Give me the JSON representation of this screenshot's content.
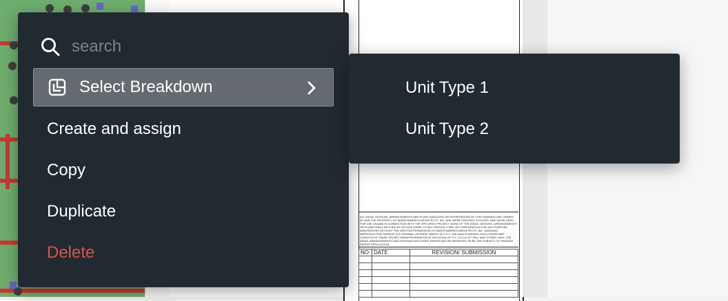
{
  "menu": {
    "search": {
      "placeholder": "search"
    },
    "items": [
      {
        "label": "Select Breakdown",
        "has_submenu": true,
        "active": true
      },
      {
        "label": "Create and assign"
      },
      {
        "label": "Copy"
      },
      {
        "label": "Duplicate"
      },
      {
        "label": "Delete",
        "danger": true
      }
    ]
  },
  "submenu": {
    "items": [
      {
        "label": "Unit Type 1"
      },
      {
        "label": "Unit Type 2"
      }
    ]
  },
  "drawing": {
    "notes": "ALL IDEAS, DESIGNS, ARRANGEMENTS AND PLANS INDICATED OR REPRESENTED BY THIS DRAWING ARE OWNED BY AND THE PROPERTY OF BAKER BARRIOS ARCHITECTS, INC. AND WERE CREATED, EVOLVED, AND DEVELOPED FOR USE ON AND IN CONNECTION WITH THE SPECIFIED PROJECT. NONE OF THE IDEAS, DESIGNS, ARRANGEMENTS OR PLANS SHALL BE USED BY OR DISCLOSED TO ANY PERSON, FIRM, OR CORPORATION FOR ANY PURPOSE WHATSOEVER WITHOUT THE WRITTEN PERMISSION OF BAKER BARRIOS ARCHITECTS, INC. WARNING: REPRODUCTION HEREOF IS A CRIMINAL OFFENSE UNDER 18 U.S.C. 506 UNAUTHORIZED DISCLOSURE MAY CONSTITUTE TRADE SECRET MISAPPROPRIATION IN VIOLATION OF S.C. 24-2-21 ET SEQ. AND OTHER LAWS. THE IDEAS, ARRANGEMENTS AND DESIGNS DISCLOSED HEREIN MAY BE PATENTED OR BE THE SUBJECT OF PENDING PATENT APPLICATION.",
    "revision_table": {
      "headers": [
        "NO",
        "DATE",
        "REVISION/ SUBMISSION"
      ]
    }
  },
  "colors": {
    "menu_bg": "#212a31",
    "active_bg": "#646a70",
    "danger": "#d9534f",
    "plan_green": "#6fae6f",
    "plan_red": "#c73a35"
  },
  "icons": {
    "search": "search-icon",
    "breakdown": "breakdown-icon",
    "chevron": "chevron-right-icon"
  }
}
